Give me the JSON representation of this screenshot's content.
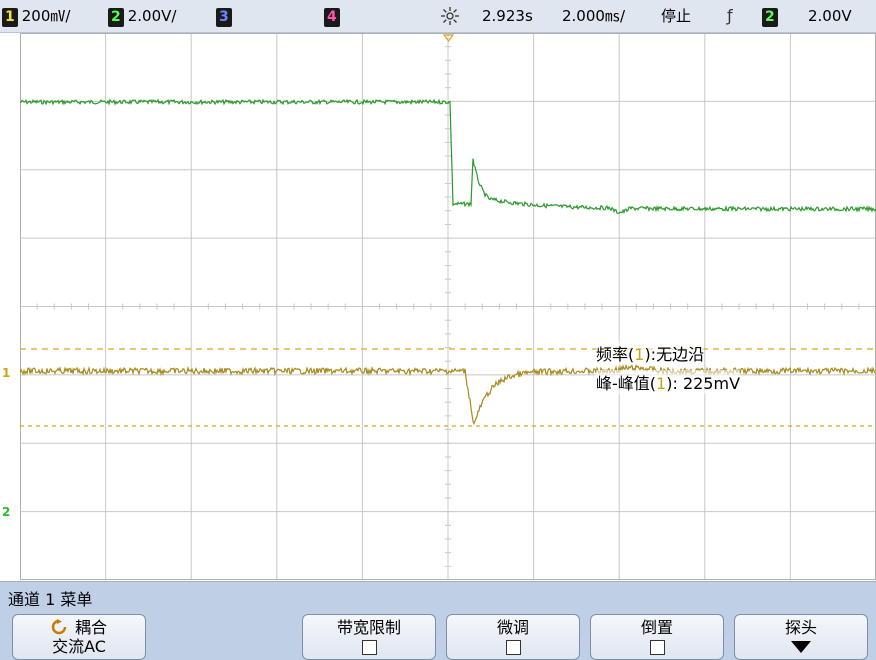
{
  "status": {
    "ch1_num": "1",
    "ch1_scale": "200㎷/",
    "ch2_num": "2",
    "ch2_scale": "2.00V/",
    "ch3_num": "3",
    "ch4_num": "4",
    "time_delay": "2.923s",
    "time_scale": "2.000㎳/",
    "run_state": "停止",
    "trigger_slope_icon": "rising-edge-icon",
    "trigger_slope": "ƒ",
    "trigger_src_num": "2",
    "trigger_level": "2.00V"
  },
  "measurements": {
    "freq_label": "频率(",
    "freq_ch": "1",
    "freq_value": "):无边沿",
    "pp_label": "峰-峰值(",
    "pp_ch": "1",
    "pp_value": "): 225mV"
  },
  "markers": {
    "ch1": "1",
    "ch2": "2"
  },
  "menu": {
    "title": "通道 1 菜单",
    "coupling_label": "耦合",
    "coupling_value": "交流AC",
    "bw_limit_label": "带宽限制",
    "fine_label": "微调",
    "invert_label": "倒置",
    "probe_label": "探头"
  },
  "colors": {
    "ch1": "#b09020",
    "ch2": "#2a9a2a",
    "grid": "#c8c8c8",
    "menu_bg": "#bfcfe6"
  }
}
